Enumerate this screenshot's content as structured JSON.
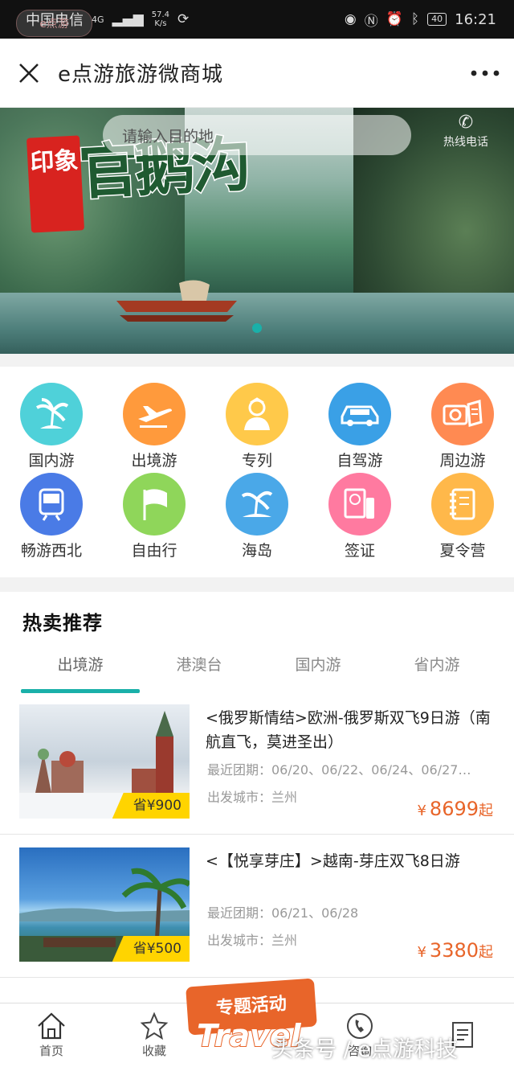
{
  "status_bar": {
    "carrier": "中国电信",
    "network": "4G",
    "speed_value": "57.4",
    "speed_unit": "K/s",
    "battery": "40",
    "time": "16:21"
  },
  "nav": {
    "title": "e点游旅游微商城"
  },
  "banner": {
    "logo_text": "e点游",
    "seal_text": "印象",
    "calligraphy": "官鹅沟",
    "search_placeholder": "请输入目的地",
    "hotline_label": "热线电话"
  },
  "categories": [
    {
      "label": "国内游",
      "color": "#4fd1d9",
      "icon": "palm-tree-icon"
    },
    {
      "label": "出境游",
      "color": "#ff9a3c",
      "icon": "airplane-icon"
    },
    {
      "label": "专列",
      "color": "#ffc94a",
      "icon": "conductor-icon"
    },
    {
      "label": "自驾游",
      "color": "#3aa0e6",
      "icon": "car-icon"
    },
    {
      "label": "周边游",
      "color": "#ff8a52",
      "icon": "camera-icon"
    },
    {
      "label": "畅游西北",
      "color": "#4a7be6",
      "icon": "train-icon"
    },
    {
      "label": "自由行",
      "color": "#8fd65a",
      "icon": "flag-icon"
    },
    {
      "label": "海岛",
      "color": "#4aa8e8",
      "icon": "island-icon"
    },
    {
      "label": "签证",
      "color": "#ff7aa0",
      "icon": "passport-icon"
    },
    {
      "label": "夏令营",
      "color": "#ffb84a",
      "icon": "notebook-icon"
    }
  ],
  "hot": {
    "title": "热卖推荐",
    "tabs": [
      "出境游",
      "港澳台",
      "国内游",
      "省内游"
    ]
  },
  "products": [
    {
      "title": "<俄罗斯情结>欧洲-俄罗斯双飞9日游（南航直飞，莫进圣出）",
      "tag": "省¥900",
      "dates": "最近团期：06/20、06/22、06/24、06/27…",
      "city": "出发城市：兰州",
      "price": "8699",
      "yen": "¥",
      "suffix": "起"
    },
    {
      "title": "<【悦享芽庄】>越南-芽庄双飞8日游",
      "tag": "省¥500",
      "dates": "最近团期：06/21、06/28",
      "city": "出发城市：兰州",
      "price": "3380",
      "yen": "¥",
      "suffix": "起"
    }
  ],
  "tabbar": {
    "items": [
      "首页",
      "收藏",
      "",
      "咨询",
      ""
    ],
    "promo_title": "专题活动",
    "promo_word": "Travel"
  },
  "watermark": "头条号 / e点游科技"
}
